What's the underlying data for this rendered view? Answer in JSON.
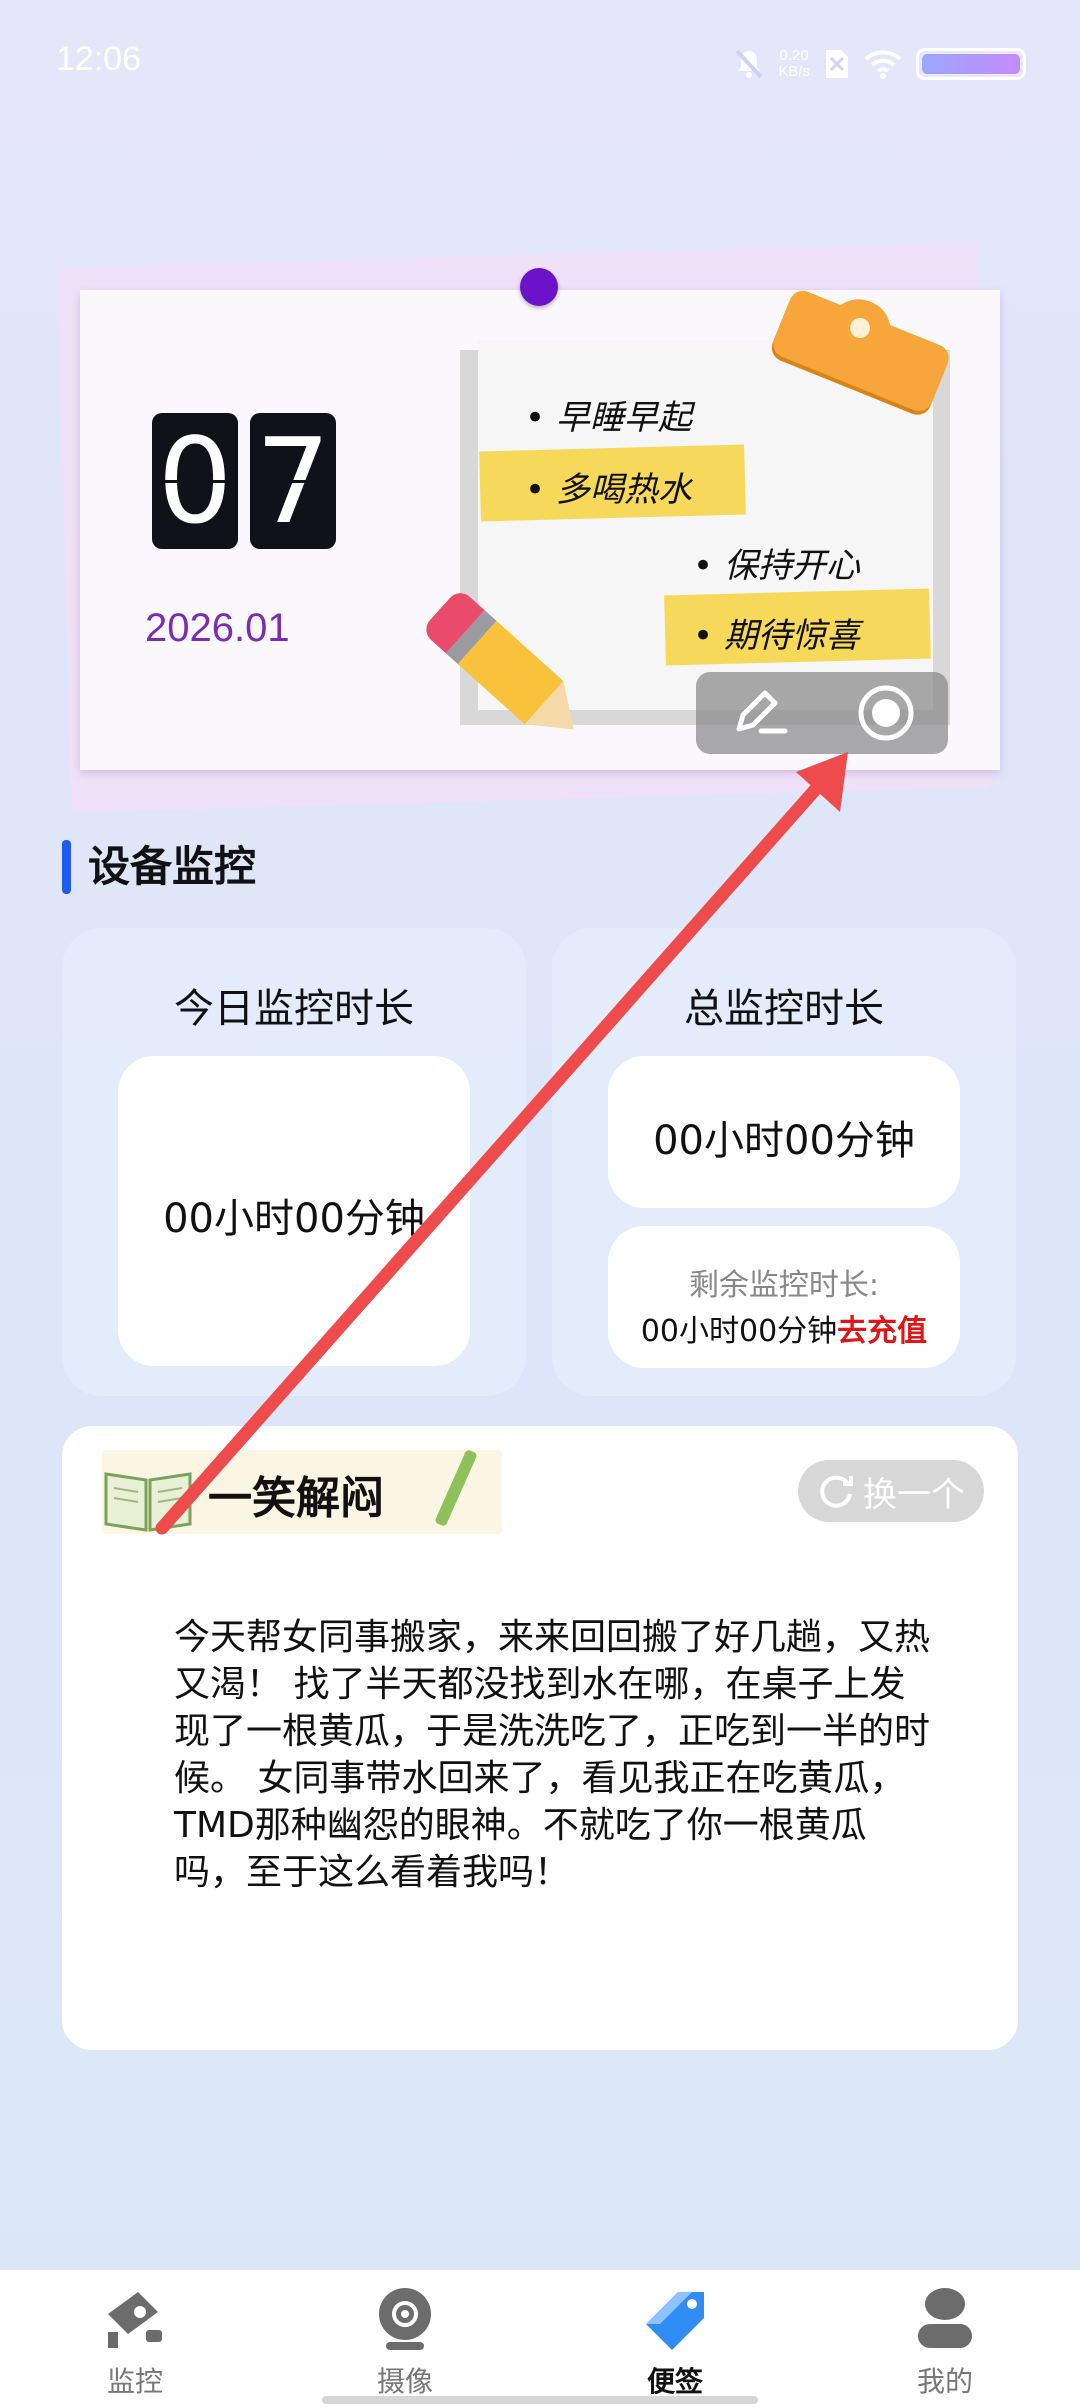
{
  "status_bar": {
    "time": "12:06",
    "net_speed_value": "0.20",
    "net_speed_unit": "KB/s"
  },
  "calendar": {
    "day_digits": [
      "0",
      "7"
    ],
    "year_month": "2026.01",
    "notes": [
      "• 早睡早起",
      "• 多喝热水",
      "• 保持开心",
      "• 期待惊喜"
    ]
  },
  "section": {
    "title": "设备监控"
  },
  "stats": {
    "today_title": "今日监控时长",
    "today_value": "00小时00分钟",
    "total_title": "总监控时长",
    "total_value": "00小时00分钟",
    "remaining_label": "剩余监控时长:",
    "remaining_value": "00小时00分钟",
    "recharge_label": "去充值"
  },
  "joke": {
    "title": "一笑解闷",
    "swap_label": "换一个",
    "text": "今天帮女同事搬家，来来回回搬了好几趟，又热又渴！ 找了半天都没找到水在哪，在桌子上发现了一根黄瓜，于是洗洗吃了，正吃到一半的时候。 女同事带水回来了，看见我正在吃黄瓜，TMD那种幽怨的眼神。不就吃了你一根黄瓜吗，至于这么看着我吗！"
  },
  "nav": {
    "items": [
      {
        "label": "监控",
        "icon": "monitor-camera-icon"
      },
      {
        "label": "摄像",
        "icon": "webcam-icon"
      },
      {
        "label": "便签",
        "icon": "tag-icon"
      },
      {
        "label": "我的",
        "icon": "person-icon"
      }
    ],
    "active_index": 2
  },
  "colors": {
    "accent_blue": "#1e5cf0",
    "recharge_red": "#e01515",
    "date_purple": "#7a2cb5",
    "arrow_red": "#ee4c4c"
  }
}
